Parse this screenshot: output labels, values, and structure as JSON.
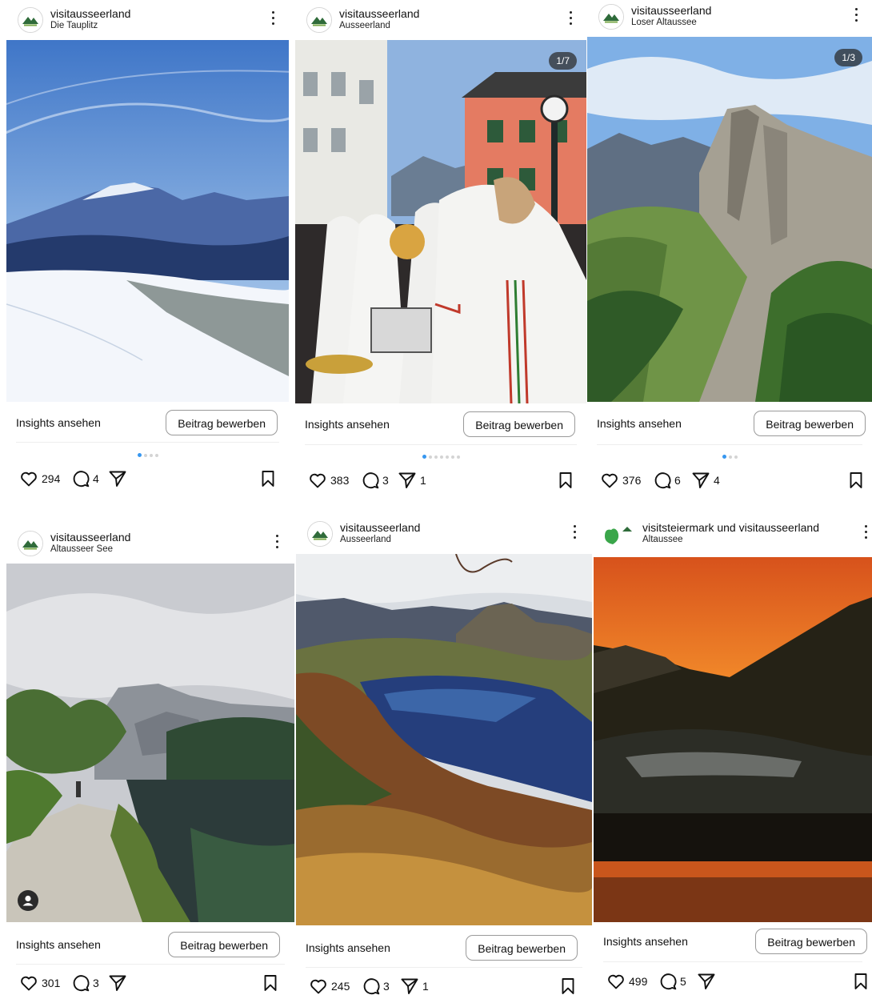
{
  "colors": {
    "accent": "#3797f0",
    "text": "#111111"
  },
  "labels": {
    "insights": "Insights ansehen",
    "promote": "Beitrag bewerben"
  },
  "icons": [
    "more-vertical-icon",
    "heart-icon",
    "comment-icon",
    "share-icon",
    "bookmark-icon",
    "user-tag-icon"
  ],
  "posts": [
    {
      "username": "visitausseerland",
      "location": "Die Tauplitz",
      "likes": "294",
      "comments": "4",
      "shares": "",
      "counter": "",
      "dots": 4,
      "active_dot": 1
    },
    {
      "username": "visitausseerland",
      "location": "Ausseerland",
      "likes": "383",
      "comments": "3",
      "shares": "1",
      "counter": "1/7",
      "dots": 7,
      "active_dot": 1
    },
    {
      "username": "visitausseerland",
      "location": "Loser Altaussee",
      "likes": "376",
      "comments": "6",
      "shares": "4",
      "counter": "1/3",
      "dots": 3,
      "active_dot": 1
    },
    {
      "username": "visitausseerland",
      "location": "Altausseer See",
      "likes": "301",
      "comments": "3",
      "shares": "",
      "counter": "",
      "dots": 0,
      "active_dot": 0
    },
    {
      "username": "visitausseerland",
      "location": "Ausseerland",
      "likes": "245",
      "comments": "3",
      "shares": "1",
      "counter": "",
      "dots": 0,
      "active_dot": 0
    },
    {
      "username": "visitsteiermark und visitausseerland",
      "location": "Altaussee",
      "likes": "499",
      "comments": "5",
      "shares": "",
      "counter": "",
      "dots": 0,
      "active_dot": 0
    }
  ]
}
